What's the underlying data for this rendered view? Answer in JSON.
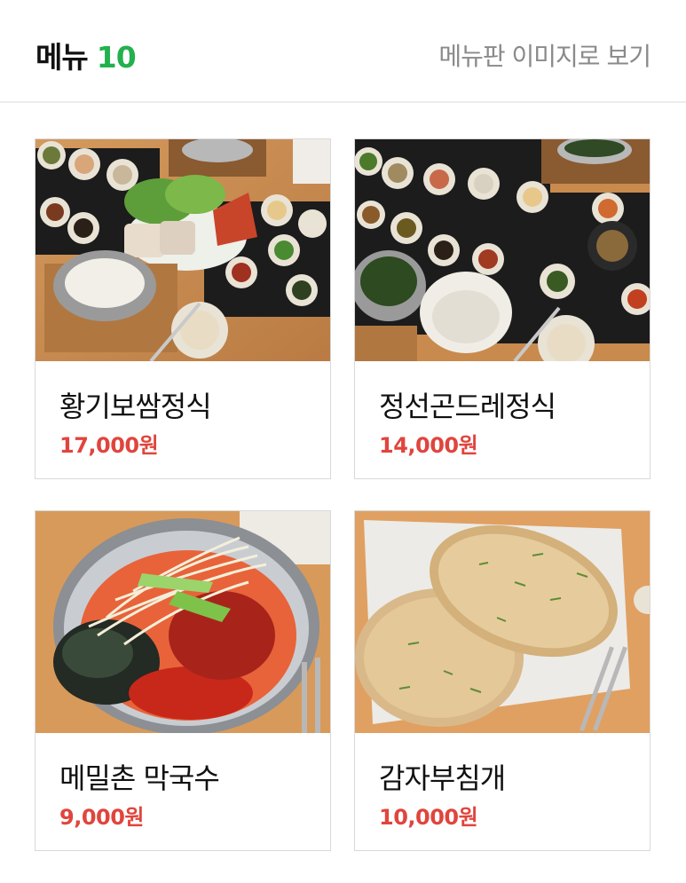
{
  "header": {
    "title": "메뉴",
    "count": "10",
    "view_as_image": "메뉴판 이미지로 보기"
  },
  "menu": [
    {
      "name": "황기보쌈정식",
      "price": "17,000원",
      "photo": "bossam-set-photo"
    },
    {
      "name": "정선곤드레정식",
      "price": "14,000원",
      "photo": "gondre-set-photo"
    },
    {
      "name": "메밀촌 막국수",
      "price": "9,000원",
      "photo": "makguksu-photo"
    },
    {
      "name": "감자부침개",
      "price": "10,000원",
      "photo": "potato-pancake-photo"
    }
  ],
  "colors": {
    "accent_green": "#22b14c",
    "price_red": "#e0453d",
    "muted_text": "#8a8a8a"
  }
}
